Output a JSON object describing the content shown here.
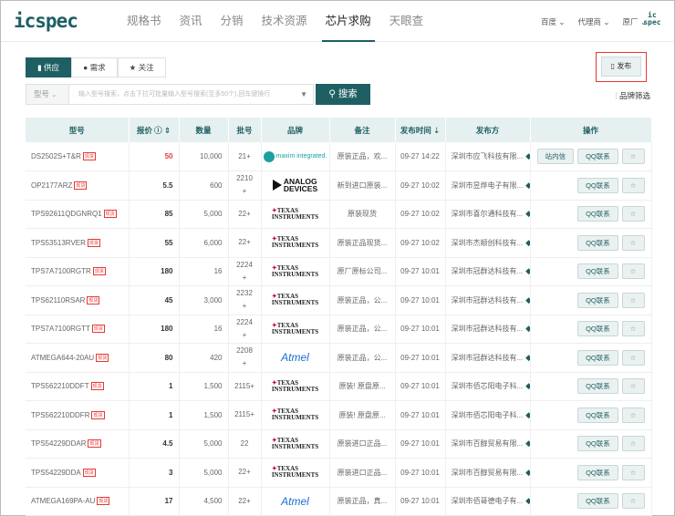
{
  "header": {
    "logo": "icspec",
    "nav": [
      "规格书",
      "资讯",
      "分销",
      "技术资源",
      "芯片求购",
      "天眼查"
    ],
    "active": 4,
    "right": [
      "百度 ⌄",
      "代理商 ⌄",
      "原厂 ⌄"
    ],
    "mini_logo": "ic spec"
  },
  "tabs": [
    "供应",
    "需求",
    "关注"
  ],
  "search": {
    "type": "型号",
    "placeholder": "输入型号搜索，点击下拉可批量输入型号搜索(至多50个),回车键换行",
    "button": "搜索"
  },
  "publish": "发布",
  "brand_filter": "品牌筛选",
  "table": {
    "headers": [
      "型号",
      "报价 ⓘ ⇕",
      "数量",
      "批号",
      "品牌",
      "备注",
      "发布时间 ⇣",
      "发布方",
      "操作"
    ],
    "tag": "现货",
    "btn_msg": "站内信",
    "btn_qq": "QQ联系",
    "star": "☆",
    "rows": [
      {
        "pn": "DS2502S+T&R",
        "price": "50",
        "qty": "10,000",
        "batch": "21+",
        "brand": "maxim",
        "brand_text": "maxim integrated.",
        "note": "原装正品，欢...",
        "time": "09-27 14:22",
        "pub": "深圳市应飞科技有限...",
        "msg": true
      },
      {
        "pn": "OP2177ARZ",
        "price": "5.5",
        "qty": "600",
        "batch": "2210 +",
        "brand": "adi",
        "brand_text": "ANALOG DEVICES",
        "note": "新到进口原装...",
        "time": "09-27 10:02",
        "pub": "深圳市昱烨电子有限..."
      },
      {
        "pn": "TPS92611QDGNRQ1",
        "price": "85",
        "qty": "5,000",
        "batch": "22+",
        "brand": "ti",
        "brand_text": "TEXAS INSTRUMENTS",
        "note": "原装现货",
        "time": "09-27 10:02",
        "pub": "深圳市喜尔通科技有..."
      },
      {
        "pn": "TPS53513RVER",
        "price": "55",
        "qty": "6,000",
        "batch": "22+",
        "brand": "ti",
        "brand_text": "TEXAS INSTRUMENTS",
        "note": "原装正品现货...",
        "time": "09-27 10:02",
        "pub": "深圳市杰顺创科技有..."
      },
      {
        "pn": "TPS7A7100RGTR",
        "price": "180",
        "qty": "16",
        "batch": "2224 +",
        "brand": "ti",
        "brand_text": "TEXAS INSTRUMENTS",
        "note": "原厂原标公司...",
        "time": "09-27 10:01",
        "pub": "深圳市冠群达科技有..."
      },
      {
        "pn": "TPS62110RSAR",
        "price": "45",
        "qty": "3,000",
        "batch": "2232 +",
        "brand": "ti",
        "brand_text": "TEXAS INSTRUMENTS",
        "note": "原装正品，公...",
        "time": "09-27 10:01",
        "pub": "深圳市冠群达科技有..."
      },
      {
        "pn": "TPS7A7100RGTT",
        "price": "180",
        "qty": "16",
        "batch": "2224 +",
        "brand": "ti",
        "brand_text": "TEXAS INSTRUMENTS",
        "note": "原装正品，公...",
        "time": "09-27 10:01",
        "pub": "深圳市冠群达科技有..."
      },
      {
        "pn": "ATMEGA644-20AU",
        "price": "80",
        "qty": "420",
        "batch": "2208 +",
        "brand": "atmel",
        "brand_text": "Atmel",
        "note": "原装正品，公...",
        "time": "09-27 10:01",
        "pub": "深圳市冠群达科技有..."
      },
      {
        "pn": "TPS562210DDFT",
        "price": "1",
        "qty": "1,500",
        "batch": "2115+",
        "brand": "ti",
        "brand_text": "TEXAS INSTRUMENTS",
        "note": "原装! 原盘原...",
        "time": "09-27 10:01",
        "pub": "深圳市佰芯阳电子科..."
      },
      {
        "pn": "TPS562210DDFR",
        "price": "1",
        "qty": "1,500",
        "batch": "2115+",
        "brand": "ti",
        "brand_text": "TEXAS INSTRUMENTS",
        "note": "原装! 原盘原...",
        "time": "09-27 10:01",
        "pub": "深圳市佰芯阳电子科..."
      },
      {
        "pn": "TPS54229DDAR",
        "price": "4.5",
        "qty": "5,000",
        "batch": "22",
        "brand": "ti",
        "brand_text": "TEXAS INSTRUMENTS",
        "note": "原装进口正品...",
        "time": "09-27 10:01",
        "pub": "深圳市百醇贸易有限..."
      },
      {
        "pn": "TPS54229DDA",
        "price": "3",
        "qty": "5,000",
        "batch": "22+",
        "brand": "ti",
        "brand_text": "TEXAS INSTRUMENTS",
        "note": "原装进口正品...",
        "time": "09-27 10:01",
        "pub": "深圳市百醇贸易有限..."
      },
      {
        "pn": "ATMEGA169PA-AU",
        "price": "17",
        "qty": "4,500",
        "batch": "22+",
        "brand": "atmel",
        "brand_text": "Atmel",
        "note": "原装正品，真...",
        "time": "09-27 10:01",
        "pub": "深圳市佰哥德电子有..."
      }
    ]
  },
  "colors": {
    "primary": "#1e5f63",
    "highlight": "#e53935"
  }
}
